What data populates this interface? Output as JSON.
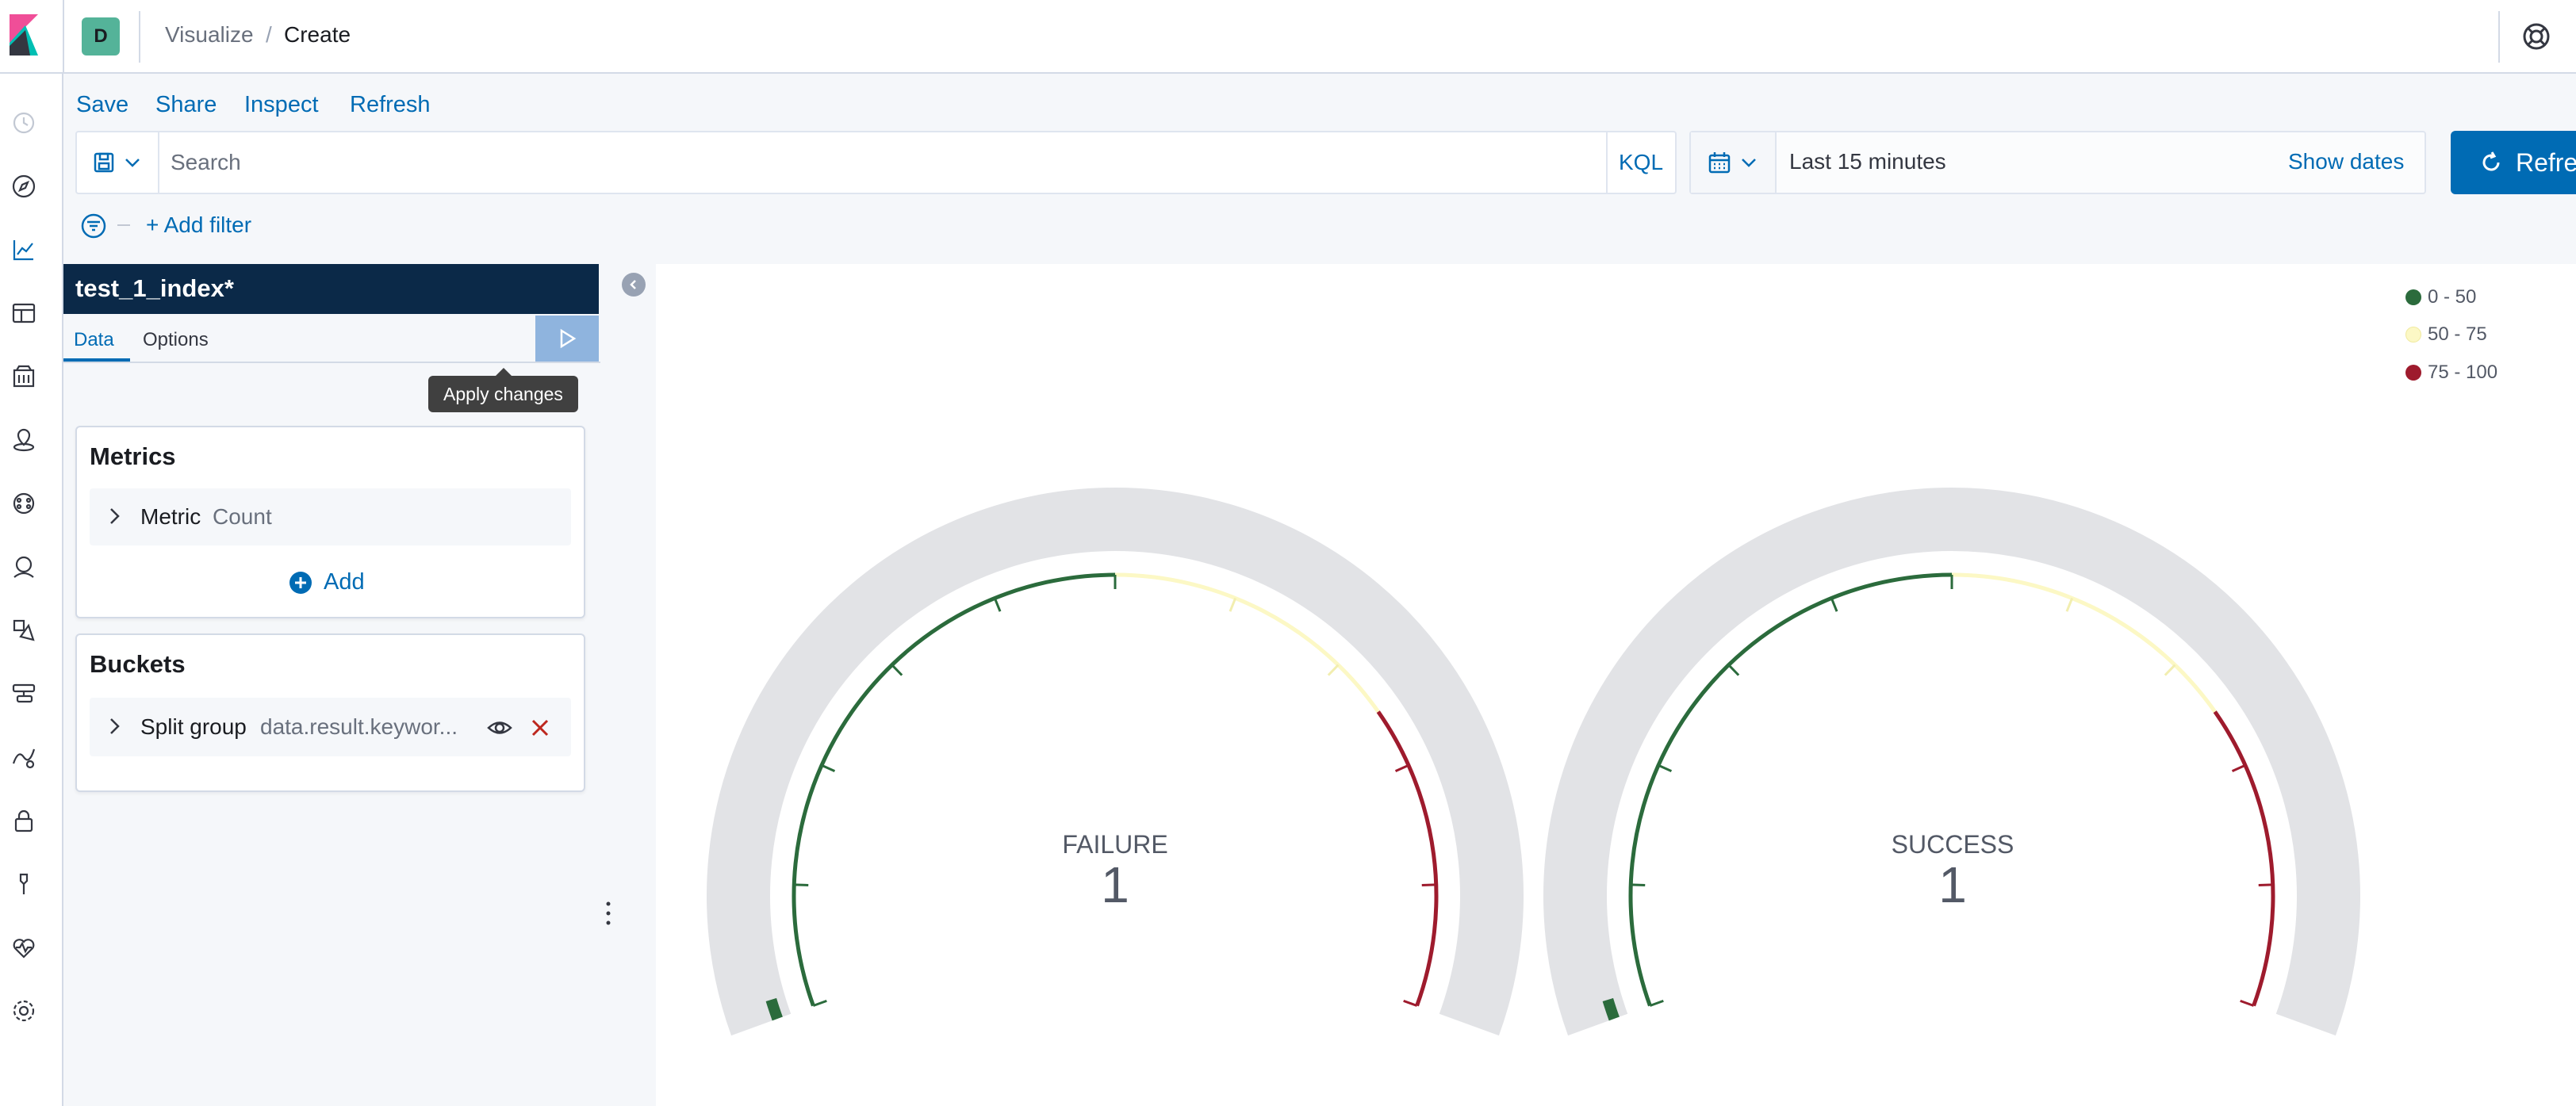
{
  "header": {
    "space_initial": "D",
    "breadcrumbs": [
      "Visualize",
      "Create"
    ],
    "breadcrumb_separator": "/"
  },
  "top_nav": {
    "links": [
      "Save",
      "Share",
      "Inspect",
      "Refresh"
    ]
  },
  "query_bar": {
    "search_placeholder": "Search",
    "language": "KQL",
    "time_range": "Last 15 minutes",
    "show_dates": "Show dates",
    "refresh_label": "Refresh"
  },
  "filter_bar": {
    "add_filter": "+ Add filter"
  },
  "sidebar": {
    "index_pattern": "test_1_index*",
    "tabs": [
      "Data",
      "Options"
    ],
    "active_tab": "Data",
    "apply_tooltip": "Apply changes",
    "metrics": {
      "title": "Metrics",
      "items": [
        {
          "label": "Metric",
          "value": "Count"
        }
      ],
      "add_label": "Add"
    },
    "buckets": {
      "title": "Buckets",
      "items": [
        {
          "label": "Split group",
          "value": "data.result.keywor..."
        }
      ]
    }
  },
  "chart_data": {
    "type": "gauge",
    "range": [
      0,
      100
    ],
    "legend": [
      {
        "label": "0 - 50",
        "color": "#2b6b3c"
      },
      {
        "label": "50 - 75",
        "color": "#fcf8c5"
      },
      {
        "label": "75 - 100",
        "color": "#9e1b2d"
      }
    ],
    "gauges": [
      {
        "label": "FAILURE",
        "value": 1
      },
      {
        "label": "SUCCESS",
        "value": 1
      }
    ]
  },
  "colors": {
    "accent": "#006bb4",
    "sidebar_title_bg": "#0b2948",
    "gauge_background": "#e2e3e6"
  },
  "icons": {
    "nav": [
      "recent-icon",
      "discover-icon",
      "visualize-icon",
      "dashboard-icon",
      "canvas-icon",
      "maps-icon",
      "ml-icon",
      "siem-icon",
      "apm-icon",
      "logs-icon",
      "uptime-icon",
      "security-icon",
      "dev-tools-icon",
      "monitoring-icon",
      "management-icon"
    ]
  }
}
